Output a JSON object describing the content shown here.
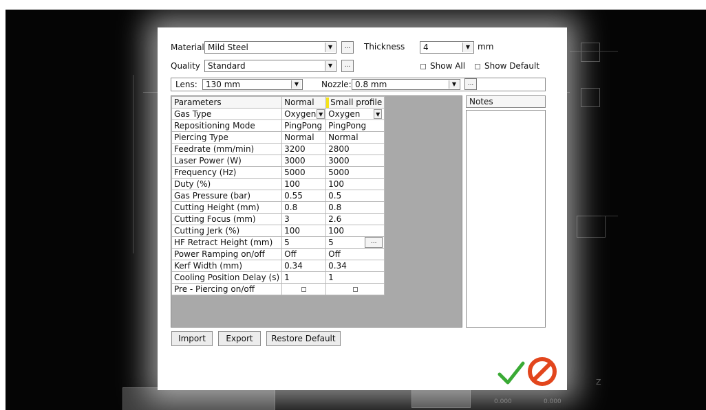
{
  "dialog": {
    "material_label": "Material",
    "material_value": "Mild Steel",
    "thickness_label": "Thickness",
    "thickness_value": "4",
    "thickness_unit": "mm",
    "quality_label": "Quality",
    "quality_value": "Standard",
    "show_all_label": "Show All",
    "show_default_label": "Show Default",
    "lens_label": "Lens:",
    "lens_value": "130 mm",
    "nozzle_label": "Nozzle:",
    "nozzle_value": "0.8 mm",
    "ellipsis": "..."
  },
  "grid": {
    "headers": [
      "Parameters",
      "Normal",
      "Small profile"
    ],
    "rows": [
      {
        "param": "Gas Type",
        "normal": "Oxygen",
        "small": "Oxygen"
      },
      {
        "param": "Repositioning Mode",
        "normal": "PingPong",
        "small": "PingPong"
      },
      {
        "param": "Piercing Type",
        "normal": "Normal",
        "small": "Normal"
      },
      {
        "param": "Feedrate (mm/min)",
        "normal": "3200",
        "small": "2800"
      },
      {
        "param": "Laser Power (W)",
        "normal": "3000",
        "small": "3000"
      },
      {
        "param": "Frequency (Hz)",
        "normal": "5000",
        "small": "5000"
      },
      {
        "param": "Duty (%)",
        "normal": "100",
        "small": "100"
      },
      {
        "param": "Gas Pressure (bar)",
        "normal": "0.55",
        "small": "0.5"
      },
      {
        "param": "Cutting Height (mm)",
        "normal": "0.8",
        "small": "0.8"
      },
      {
        "param": "Cutting Focus (mm)",
        "normal": "3",
        "small": "2.6"
      },
      {
        "param": "Cutting Jerk (%)",
        "normal": "100",
        "small": "100"
      },
      {
        "param": "HF Retract Height (mm)",
        "normal": "5",
        "small": "5"
      },
      {
        "param": "Power Ramping on/off",
        "normal": "Off",
        "small": "Off"
      },
      {
        "param": "Kerf Width (mm)",
        "normal": "0.34",
        "small": "0.34"
      },
      {
        "param": "Cooling Position Delay (s)",
        "normal": "1",
        "small": "1"
      },
      {
        "param": "Pre - Piercing on/off",
        "normal": "",
        "small": ""
      }
    ]
  },
  "notes": {
    "header": "Notes"
  },
  "buttons": {
    "import": "Import",
    "export": "Export",
    "restore": "Restore Default"
  },
  "background": {
    "value_1": "0.000",
    "value_2": "0.000",
    "axis_label": "Z"
  },
  "colors": {
    "ok": "#3aaa35",
    "cancel": "#e2461d",
    "highlight": "#f4e21a",
    "grid_bg": "#a9a9a9"
  },
  "icons": {
    "ok": "checkmark-icon",
    "cancel": "cancel-icon"
  }
}
